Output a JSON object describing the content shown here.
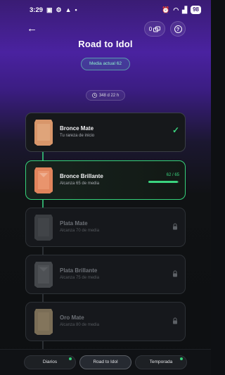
{
  "status_bar": {
    "time": "3:29",
    "battery": "98"
  },
  "header": {
    "title": "Road to Idol",
    "coins_count": "0",
    "average_badge": "Media actual 62",
    "time_remaining": "348 d 22 h"
  },
  "tiers": [
    {
      "name": "Bronce Mate",
      "subtitle": "Tu rareza de inicio",
      "state": "completed",
      "color": "#d8966a"
    },
    {
      "name": "Bronce Brillante",
      "subtitle": "Alcanza 65 de media",
      "state": "active",
      "color": "#e0845c",
      "progress_text": "62 / 65",
      "progress": 0.95
    },
    {
      "name": "Plata Mate",
      "subtitle": "Alcanza 70 de media",
      "state": "locked",
      "color": "#3a3d41"
    },
    {
      "name": "Plata Brillante",
      "subtitle": "Alcanza 75 de media",
      "state": "locked",
      "color": "#44474b"
    },
    {
      "name": "Oro Mate",
      "subtitle": "Alcanza 80 de media",
      "state": "locked",
      "color": "#7a6d56"
    }
  ],
  "bottom_nav": {
    "tabs": [
      {
        "label": "Diarios",
        "has_dot": true
      },
      {
        "label": "Road to Idol",
        "has_dot": false
      },
      {
        "label": "Temporada",
        "has_dot": true
      }
    ]
  },
  "colors": {
    "accent_green": "#35d27a",
    "header_purple": "#4a22a0"
  }
}
